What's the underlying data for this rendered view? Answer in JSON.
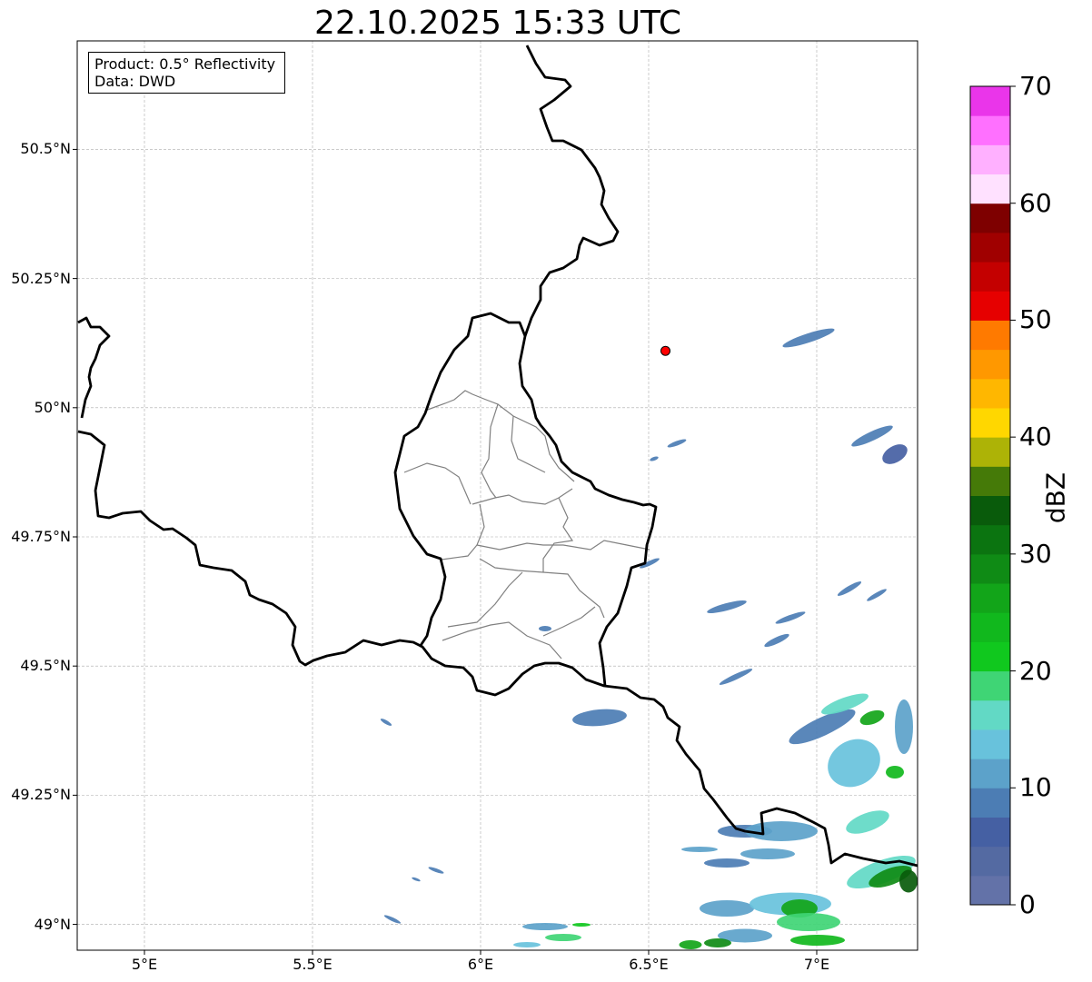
{
  "title": "22.10.2025 15:33 UTC",
  "info": {
    "product": "Product: 0.5° Reflectivity",
    "source": "Data: DWD"
  },
  "axes": {
    "lat_ticks": [
      "50.5°N",
      "50.25°N",
      "50°N",
      "49.75°N",
      "49.5°N",
      "49.25°N",
      "49°N"
    ],
    "lon_ticks": [
      "5°E",
      "5.5°E",
      "6°E",
      "6.5°E",
      "7°E"
    ],
    "lat_range": [
      48.95,
      50.71
    ],
    "lon_range": [
      4.8,
      7.3
    ],
    "grid": true
  },
  "colorbar": {
    "unit": "dBZ",
    "tick_labels": [
      "0",
      "10",
      "20",
      "30",
      "40",
      "50",
      "60",
      "70"
    ],
    "range": [
      0,
      70
    ],
    "colors": [
      "#6372a8",
      "#546aa2",
      "#4560a3",
      "#4c7db4",
      "#5ca2ca",
      "#68c2dc",
      "#62d9c5",
      "#3fd575",
      "#10c81e",
      "#11b81d",
      "#12a519",
      "#0f8b15",
      "#0b7410",
      "#095b0b",
      "#457a08",
      "#adb306",
      "#ffd700",
      "#ffb700",
      "#ff9800",
      "#ff7a00",
      "#e60000",
      "#c40000",
      "#a00000",
      "#7e0000",
      "#ffe1ff",
      "#ffb0ff",
      "#ff70ff",
      "#ea35ea"
    ]
  },
  "marker": {
    "lat": 50.11,
    "lon": 6.55,
    "color": "#ff0000"
  }
}
